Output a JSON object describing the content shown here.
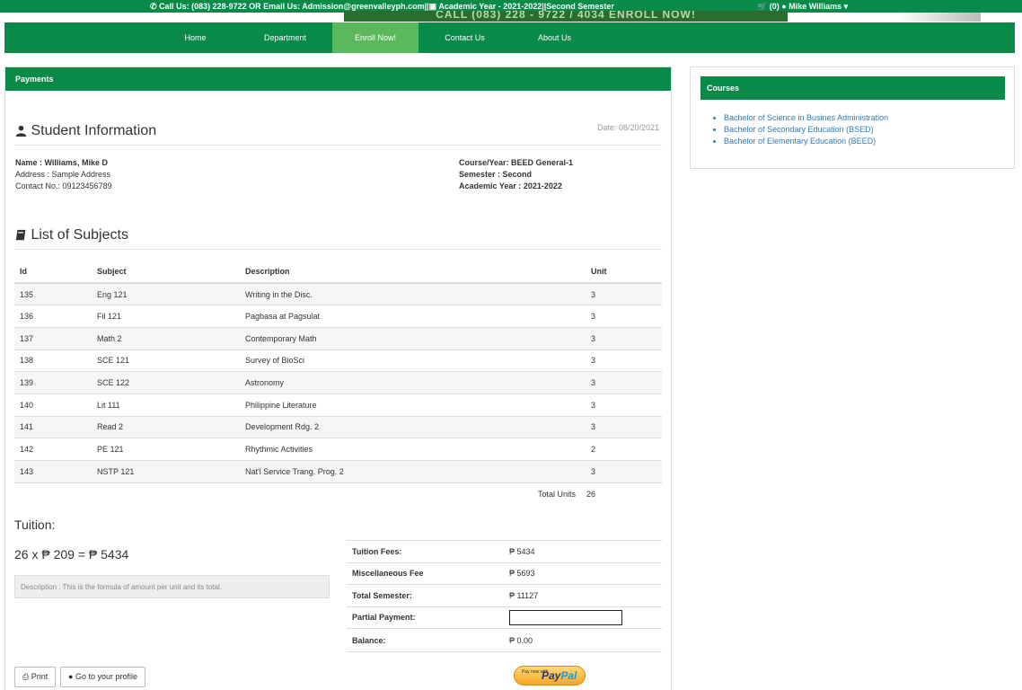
{
  "topbar": {
    "contact": "Call Us: (083) 228-9722 OR Email Us: Admission@greenvalleyph.com||",
    "academic": "Academic Year - 2021-2022||Second Semester",
    "banner": "CALL (083) 228 - 9722 / 4034 ENROLL NOW!",
    "cart": "(0)",
    "user": "Mike Williams"
  },
  "nav": {
    "items": [
      "Home",
      "Department",
      "Enroll Now!",
      "Contact Us",
      "About Us"
    ]
  },
  "main": {
    "panel_title": "Payments",
    "student_heading": "Student Information",
    "date": "Date: 08/20/2021",
    "name": "Name : Williams, Mike D",
    "address": "Address : Sample Address",
    "contact": "Contact No.: 09123456789",
    "course": "Course/Year: BEED General-1",
    "semester": "Semester : Second",
    "academic_year": "Academic Year : 2021-2022",
    "subjects_heading": "List of Subjects",
    "table_headers": [
      "Id",
      "Subject",
      "Description",
      "Unit"
    ],
    "subjects": [
      [
        "135",
        "Eng 121",
        "Writing in the Disc.",
        "3"
      ],
      [
        "136",
        "Fil 121",
        "Pagbasa at Pagsulat",
        "3"
      ],
      [
        "137",
        "Math 2",
        "Contemporary Math",
        "3"
      ],
      [
        "138",
        "SCE 121",
        "Survey of BioSci",
        "3"
      ],
      [
        "139",
        "SCE 122",
        "Astronomy",
        "3"
      ],
      [
        "140",
        "Lit 111",
        "Philippine Literature",
        "3"
      ],
      [
        "141",
        "Read 2",
        "Development Rdg. 2",
        "3"
      ],
      [
        "142",
        "PE 121",
        "Rhythmic Activities",
        "2"
      ],
      [
        "143",
        "NSTP 121",
        "Nat'l Service Trang. Prog. 2",
        "3"
      ]
    ],
    "total_label": "Total Units",
    "total_value": "26",
    "tuition_heading": "Tuition:",
    "formula": "26 x ₱ 209 = ₱ 5434",
    "formula_desc": "Description : This is the formula of amount per unit and its total.",
    "fees": {
      "tuition_label": "Tuition Fees:",
      "tuition_value": "₱ 5434",
      "misc_label": "Miscellaneous Fee",
      "misc_value": "₱ 5693",
      "total_label": "Total Semester:",
      "total_value": "₱ 11127",
      "partial_label": "Partial Payment:",
      "partial_value": "",
      "balance_label": "Balance:",
      "balance_value": "₱ 0.00"
    },
    "print_label": "Print",
    "profile_label": "Go to your profile",
    "paypal_small": "Pay now with",
    "paypal_a": "Pay",
    "paypal_b": "Pal"
  },
  "side": {
    "title": "Courses",
    "courses": [
      "Bachelor of Science in Busines Administration",
      "Bachelor of Secondary Education (BSED)",
      "Bachelor of Elementary Education (BEED)"
    ]
  },
  "colors": {
    "brand": "#0a8a48",
    "active": "#5cb85c",
    "link": "#337ab7"
  }
}
